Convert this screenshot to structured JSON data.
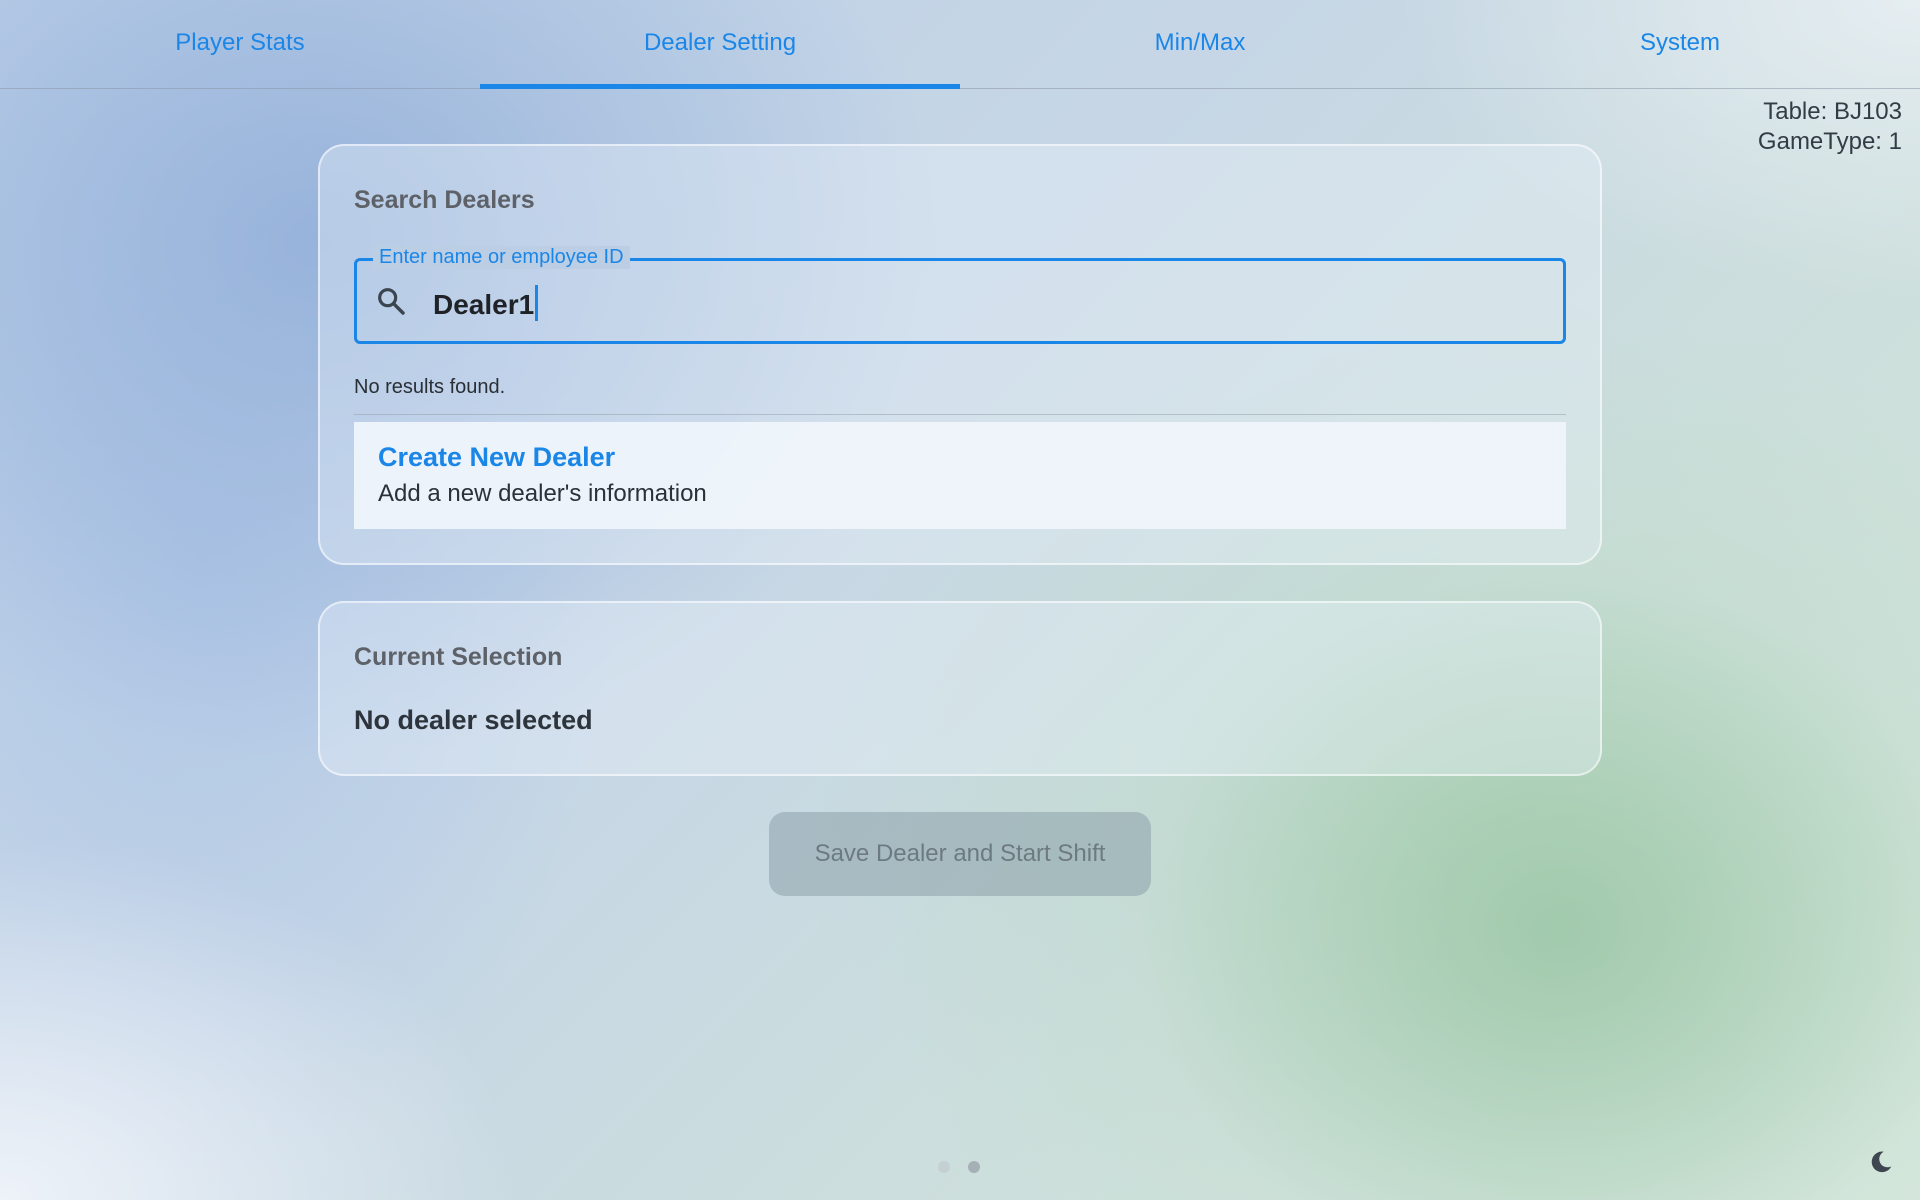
{
  "tabs": [
    {
      "label": "Player Stats",
      "active": false
    },
    {
      "label": "Dealer Setting",
      "active": true
    },
    {
      "label": "Min/Max",
      "active": false
    },
    {
      "label": "System",
      "active": false
    }
  ],
  "table_info": {
    "table": "Table: BJ103",
    "game_type": "GameType: 1"
  },
  "search_card": {
    "title": "Search Dealers",
    "field_label": "Enter name or employee ID",
    "field_value": "Dealer1",
    "icon": "search-icon",
    "no_results": "No results found.",
    "create_title": "Create New Dealer",
    "create_subtitle": "Add a new dealer's information"
  },
  "current_card": {
    "title": "Current Selection",
    "value": "No dealer selected"
  },
  "save_button": {
    "label": "Save Dealer and Start Shift",
    "enabled": false
  },
  "pager": {
    "pages": 2,
    "current": 2
  },
  "theme_toggle": {
    "icon": "moon-icon"
  },
  "colors": {
    "accent": "#1a86e8",
    "text_dark": "#2d343c",
    "disabled_button": "#8ca0aa"
  }
}
